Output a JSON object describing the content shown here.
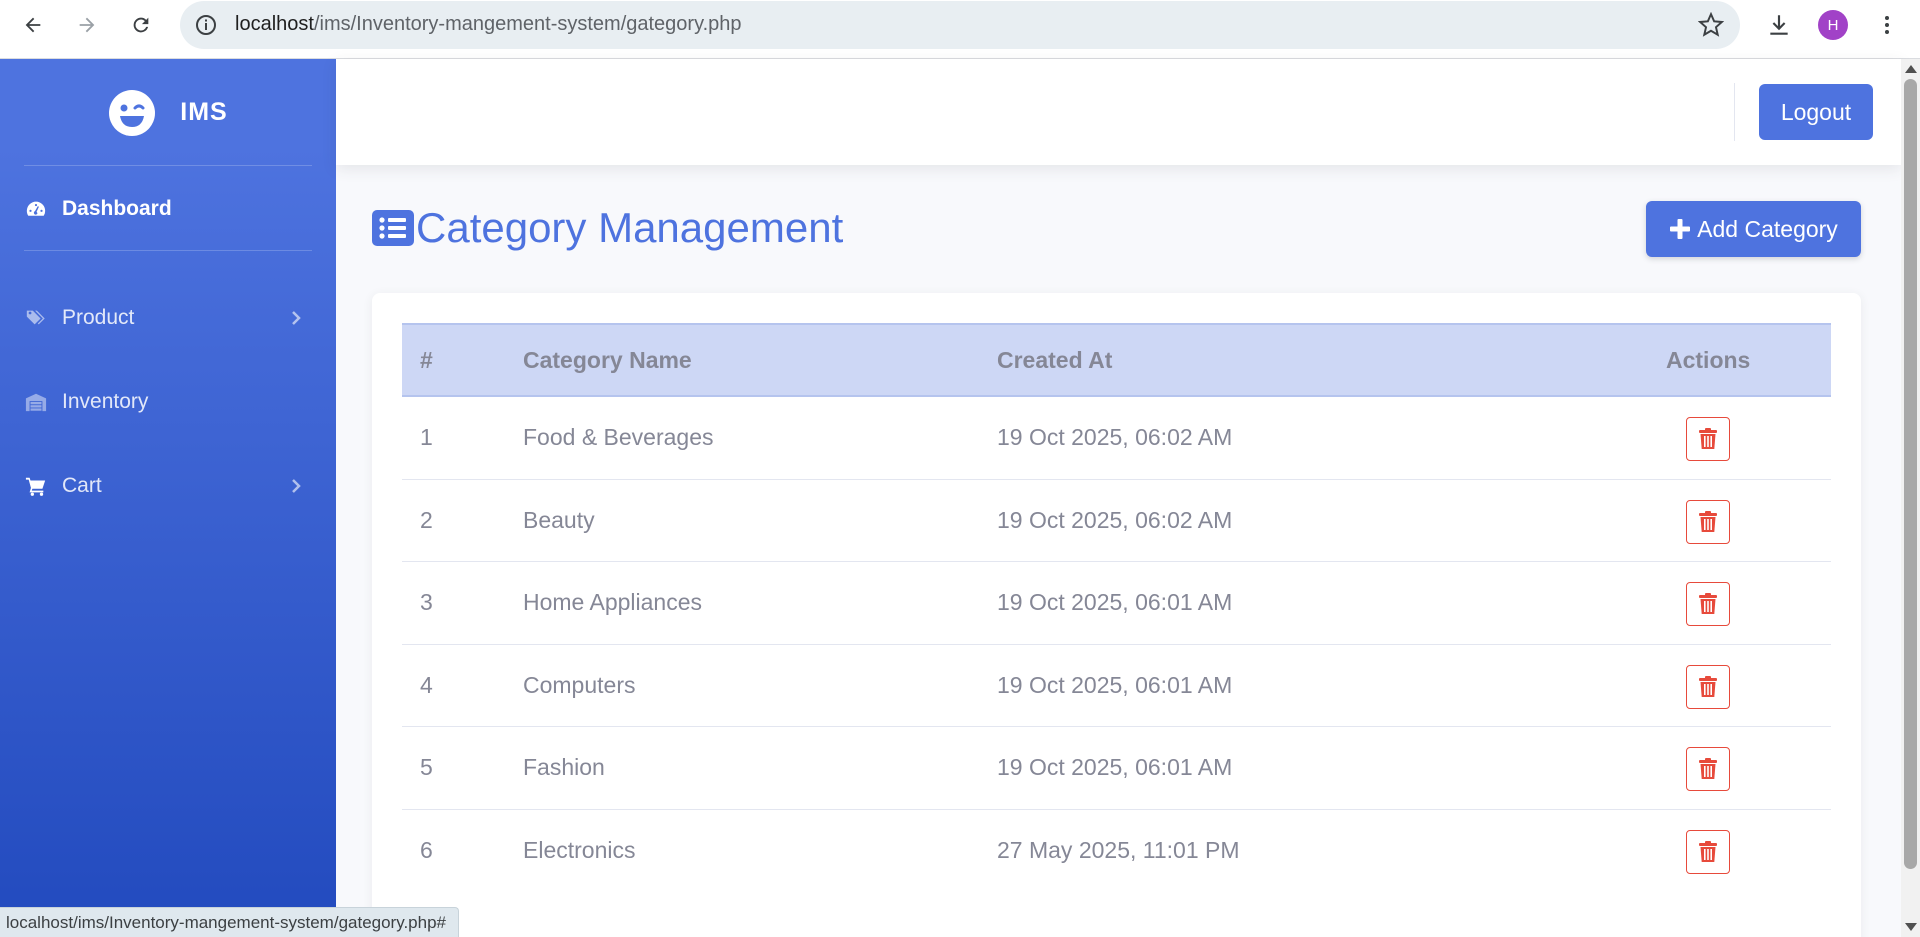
{
  "browser": {
    "url_host": "localhost",
    "url_path": "/ims/Inventory-mangement-system/gategory.php",
    "profile_initial": "H",
    "status_url": "localhost/ims/Inventory-mangement-system/gategory.php#"
  },
  "sidebar": {
    "brand": "IMS",
    "items": [
      {
        "label": "Dashboard",
        "icon": "gauge-icon",
        "active": true
      },
      {
        "label": "Product",
        "icon": "tags-icon",
        "chevron": true
      },
      {
        "label": "Inventory",
        "icon": "warehouse-icon"
      },
      {
        "label": "Cart",
        "icon": "cart-icon",
        "chevron": true
      }
    ]
  },
  "topbar": {
    "logout_label": "Logout"
  },
  "main": {
    "title": "Category Management",
    "add_label": "Add Category",
    "table": {
      "headers": [
        "#",
        "Category Name",
        "Created At",
        "Actions"
      ],
      "rows": [
        {
          "num": "1",
          "name": "Food & Beverages",
          "created": "19 Oct 2025, 06:02 AM"
        },
        {
          "num": "2",
          "name": "Beauty",
          "created": "19 Oct 2025, 06:02 AM"
        },
        {
          "num": "3",
          "name": "Home Appliances",
          "created": "19 Oct 2025, 06:01 AM"
        },
        {
          "num": "4",
          "name": "Computers",
          "created": "19 Oct 2025, 06:01 AM"
        },
        {
          "num": "5",
          "name": "Fashion",
          "created": "19 Oct 2025, 06:01 AM"
        },
        {
          "num": "6",
          "name": "Electronics",
          "created": "27 May 2025, 11:01 PM"
        }
      ]
    }
  },
  "colors": {
    "primary": "#4e73df",
    "danger": "#e74a3b",
    "table_header": "#cdd7f5",
    "text_muted": "#858796"
  }
}
